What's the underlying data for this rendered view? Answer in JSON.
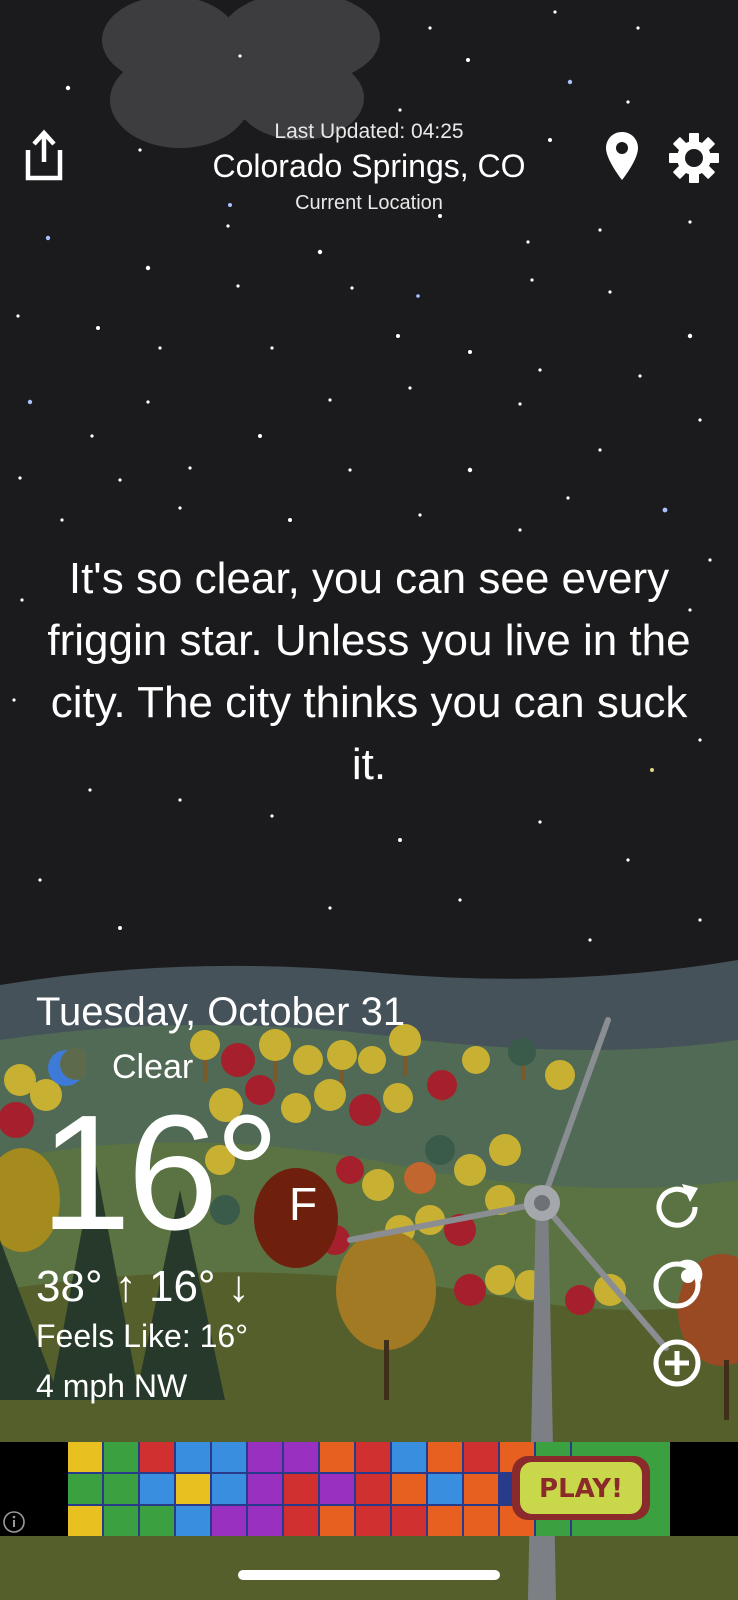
{
  "header": {
    "last_updated": "Last Updated: 04:25",
    "location": "Colorado Springs, CO",
    "location_subtitle": "Current Location"
  },
  "quote": "It's so clear, you can see every friggin star. Unless you live in the city. The city thinks you can suck it.",
  "weather": {
    "date": "Tuesday, October 31",
    "condition": "Clear",
    "condition_icon": "crescent-moon-icon",
    "temperature": "16°",
    "unit": "F",
    "high_low": "38° ↑  16° ↓",
    "feels_like": "Feels Like: 16°",
    "wind": "4 mph NW"
  },
  "icons": {
    "share": "share-icon",
    "location": "location-pin-icon",
    "settings": "gear-icon",
    "refresh": "refresh-icon",
    "theme": "theme-icon",
    "add": "add-icon"
  },
  "ad": {
    "play_label": "PLAY!"
  },
  "colors": {
    "night_sky": "#1b1b1d",
    "ad_bar": "#000000",
    "unit_badge": "#6e200c",
    "moon": "#3e7bd8"
  }
}
